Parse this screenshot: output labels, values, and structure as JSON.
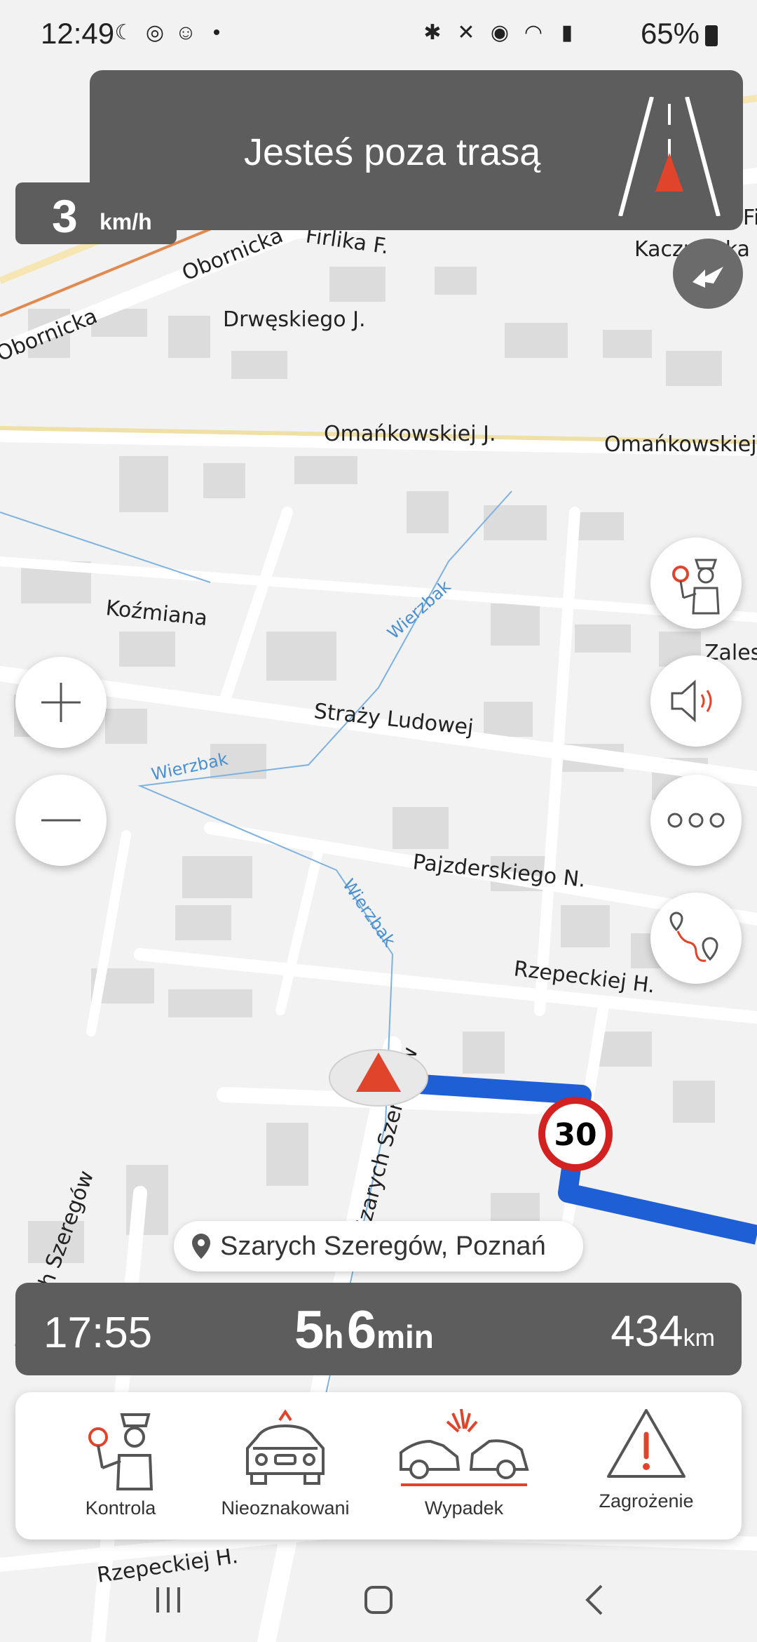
{
  "status_bar": {
    "time": "12:49",
    "battery": "65%",
    "icons": [
      "moon-icon",
      "speed-limit-65-icon",
      "smiley-icon",
      "dot-icon",
      "bluetooth-icon",
      "mute-icon",
      "location-icon",
      "wifi-icon",
      "lte-signal-icon",
      "battery-icon"
    ]
  },
  "banner": {
    "message": "Jesteś poza trasą"
  },
  "speed": {
    "value": "3",
    "unit": "km/h"
  },
  "map": {
    "street_labels": [
      "Obornicka",
      "Obornicka",
      "Firlika F.",
      "Drwęskiego J.",
      "Kaczmarka I.",
      "Omańkowskiej J.",
      "Omańkowskiej",
      "Koźmiana",
      "Straży Ludowej",
      "Pajzderskiego N.",
      "Rzepeckiej H.",
      "Szarych Szeregów",
      "Szarych Szeregów",
      "Rzepeckiej H.",
      "Zales",
      "Fi",
      "Obornicka"
    ],
    "water_labels": [
      "Wierzbak",
      "Wierzbak",
      "Wierzbak"
    ],
    "speed_limit_sign": "30",
    "route_color": "#1f5fd6",
    "accent_color": "#e0442a"
  },
  "controls": {
    "zoom_in": "zoom-in",
    "zoom_out": "zoom-out"
  },
  "location": {
    "label": "Szarych Szeregów, Poznań"
  },
  "trip": {
    "eta": "17:55",
    "hours": "5",
    "hours_unit": "h",
    "minutes": "6",
    "minutes_unit": "min",
    "distance": "434",
    "distance_unit": "km"
  },
  "reports": [
    {
      "label": "Kontrola"
    },
    {
      "label": "Nieoznakowani"
    },
    {
      "label": "Wypadek"
    },
    {
      "label": "Zagrożenie"
    }
  ]
}
